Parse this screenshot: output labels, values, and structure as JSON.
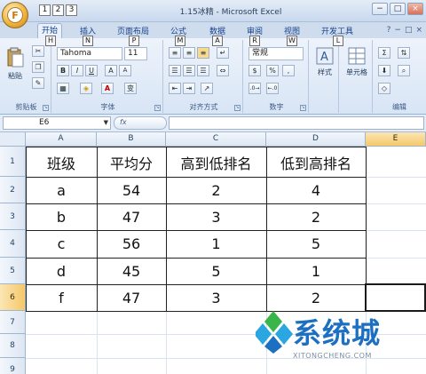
{
  "window": {
    "title": "1.15冰精 - Microsoft Excel",
    "office_button_key": "F",
    "qat_keys": [
      "1",
      "2",
      "3"
    ],
    "controls": {
      "minimize": "−",
      "restore": "□",
      "close": "×"
    }
  },
  "tabs": [
    {
      "label": "开始",
      "key": "H",
      "active": true
    },
    {
      "label": "插入",
      "key": "N"
    },
    {
      "label": "页面布局",
      "key": "P"
    },
    {
      "label": "公式",
      "key": "M"
    },
    {
      "label": "数据",
      "key": "A"
    },
    {
      "label": "审阅",
      "key": "R"
    },
    {
      "label": "视图",
      "key": "W"
    },
    {
      "label": "开发工具",
      "key": "L"
    }
  ],
  "ribbon_right": {
    "help": "?",
    "min": "−",
    "restore": "□",
    "close": "×"
  },
  "ribbon": {
    "clipboard": {
      "label": "剪贴板",
      "paste": "粘贴"
    },
    "font": {
      "label": "字体",
      "name": "Tahoma",
      "size": "11",
      "bold": "B",
      "italic": "I",
      "underline": "U",
      "grow": "A",
      "shrink": "A",
      "wen": "变"
    },
    "alignment": {
      "label": "对齐方式"
    },
    "number": {
      "label": "数字",
      "format": "常规",
      "percent": "%",
      "comma": ","
    },
    "styles": {
      "label": "样式"
    },
    "cells": {
      "label": "单元格"
    },
    "editing": {
      "label": "编辑"
    }
  },
  "formula_bar": {
    "name_box": "E6",
    "formula": "",
    "fx": "fx"
  },
  "grid": {
    "columns": [
      "A",
      "B",
      "C",
      "D",
      "E"
    ],
    "rows": [
      "1",
      "2",
      "3",
      "4",
      "5",
      "6",
      "7",
      "8",
      "9"
    ],
    "selected_column": "E",
    "selected_row": "6",
    "table": {
      "headers": [
        "班级",
        "平均分",
        "高到低排名",
        "低到高排名"
      ],
      "rows": [
        [
          "a",
          "54",
          "2",
          "4"
        ],
        [
          "b",
          "47",
          "3",
          "2"
        ],
        [
          "c",
          "56",
          "1",
          "5"
        ],
        [
          "d",
          "45",
          "5",
          "1"
        ],
        [
          "f",
          "47",
          "3",
          "2"
        ]
      ]
    }
  },
  "watermark": {
    "text": "系统城",
    "url": "XITONGCHENG.COM",
    "colors": [
      "#2aa6e0",
      "#3ab54a",
      "#1c6fc1"
    ]
  }
}
